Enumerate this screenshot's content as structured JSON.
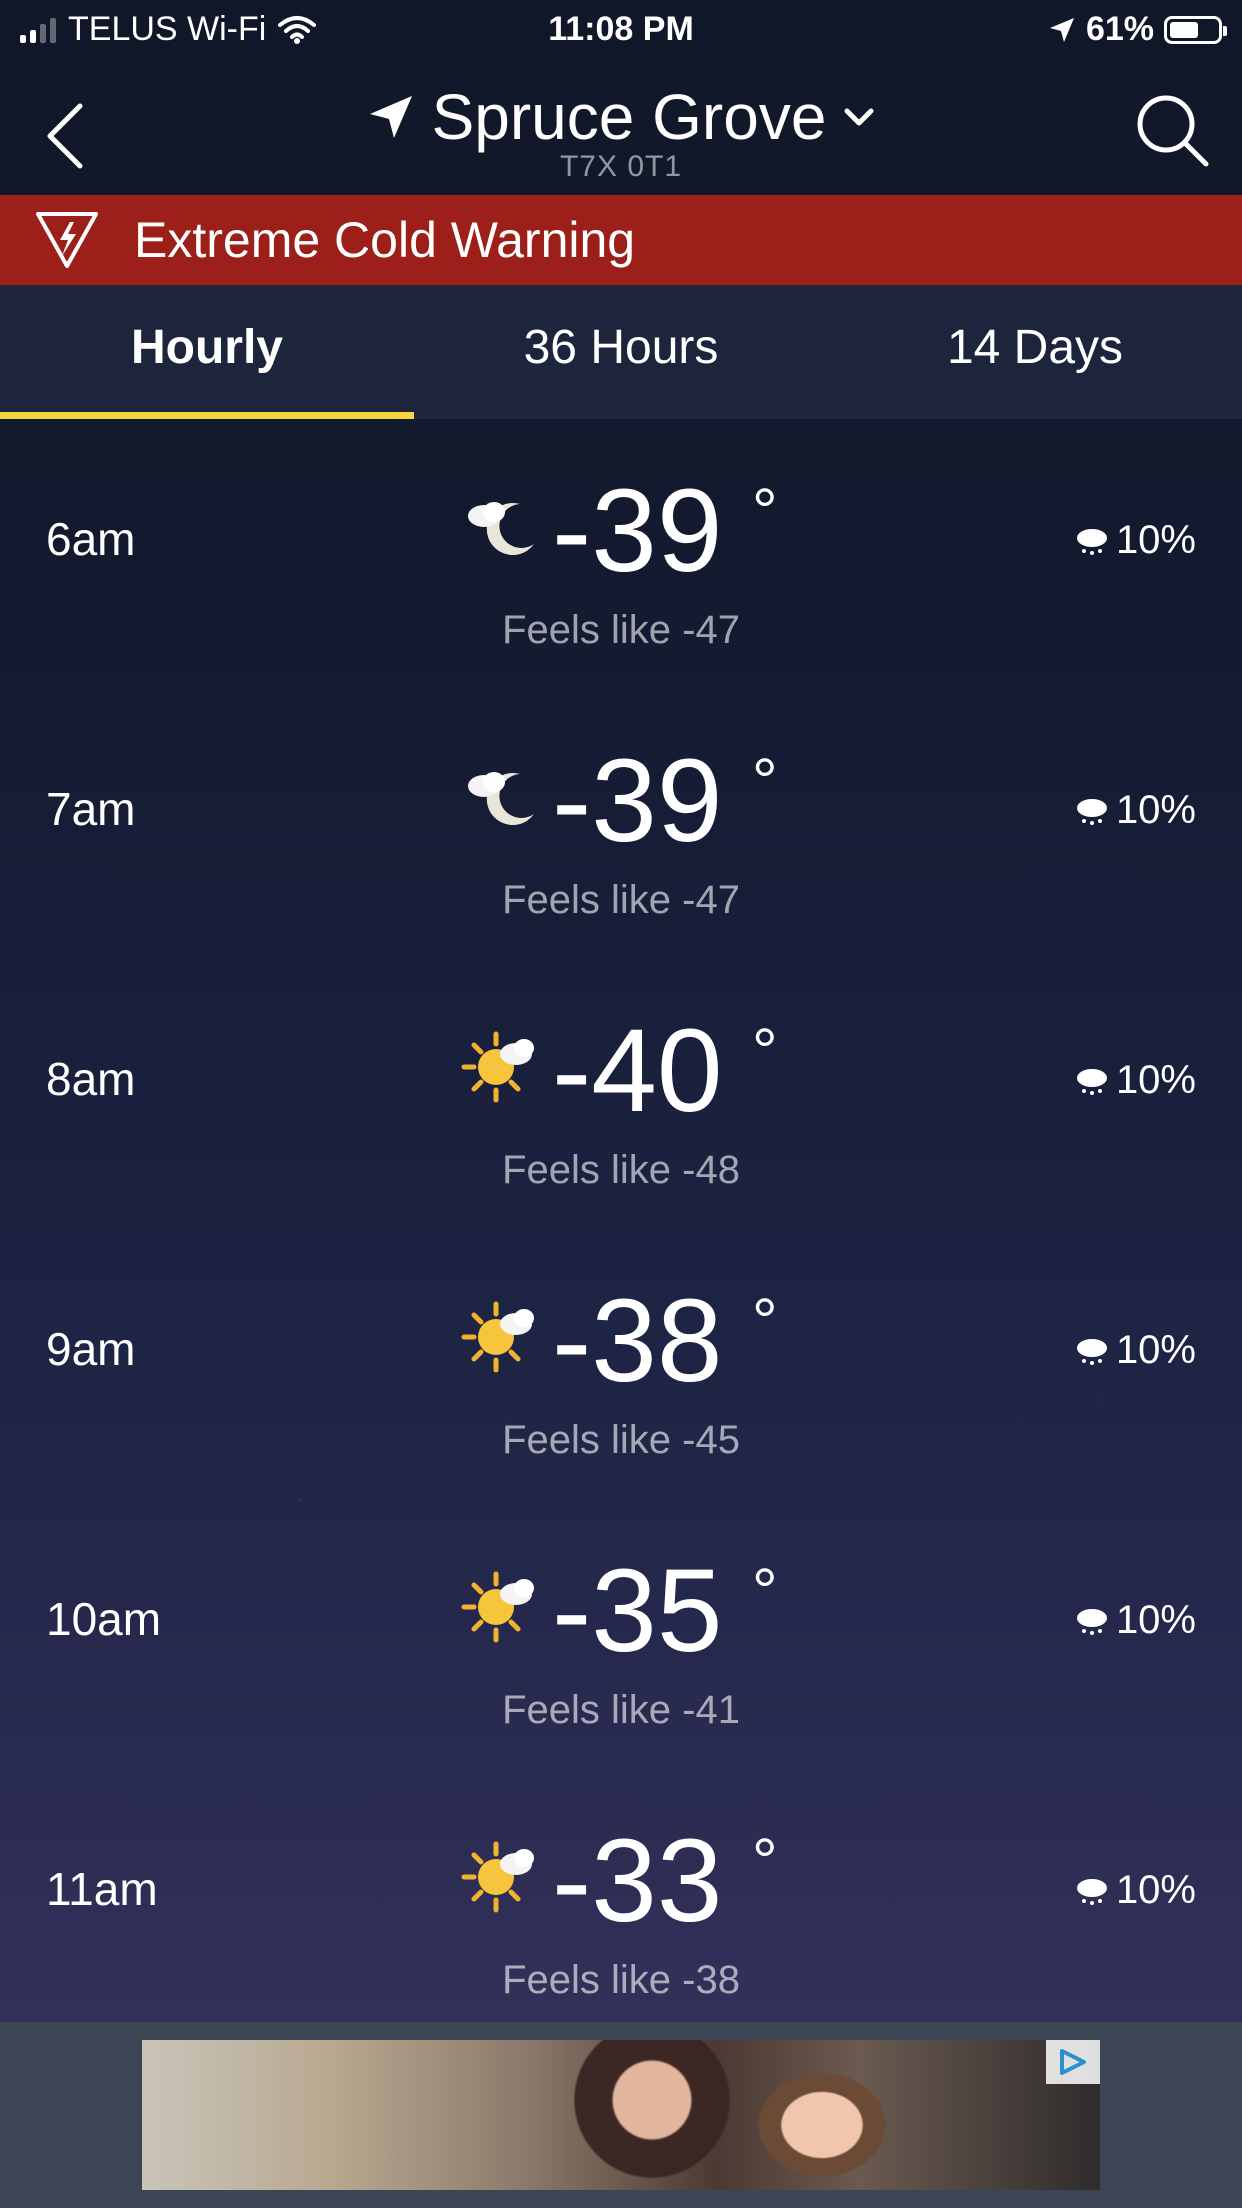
{
  "status_bar": {
    "carrier": "TELUS Wi-Fi",
    "time": "11:08 PM",
    "battery": "61%",
    "battery_level": 0.61
  },
  "header": {
    "city": "Spruce Grove",
    "postal": "T7X 0T1"
  },
  "alert": {
    "text": "Extreme Cold Warning"
  },
  "tabs": [
    {
      "label": "Hourly",
      "active": true
    },
    {
      "label": "36 Hours",
      "active": false
    },
    {
      "label": "14 Days",
      "active": false
    }
  ],
  "hours": [
    {
      "time": "6am",
      "icon": "moon-cloud-icon",
      "temp": "-39",
      "feels": "Feels like -47",
      "precip": "10%"
    },
    {
      "time": "7am",
      "icon": "moon-cloud-icon",
      "temp": "-39",
      "feels": "Feels like -47",
      "precip": "10%"
    },
    {
      "time": "8am",
      "icon": "sun-cloud-icon",
      "temp": "-40",
      "feels": "Feels like -48",
      "precip": "10%"
    },
    {
      "time": "9am",
      "icon": "sun-cloud-icon",
      "temp": "-38",
      "feels": "Feels like -45",
      "precip": "10%"
    },
    {
      "time": "10am",
      "icon": "sun-cloud-icon",
      "temp": "-35",
      "feels": "Feels like -41",
      "precip": "10%"
    },
    {
      "time": "11am",
      "icon": "sun-cloud-icon",
      "temp": "-33",
      "feels": "Feels like -38",
      "precip": "10%"
    }
  ],
  "colors": {
    "alert_bg": "#9c1f1a",
    "tab_indicator": "#f6d43c"
  }
}
